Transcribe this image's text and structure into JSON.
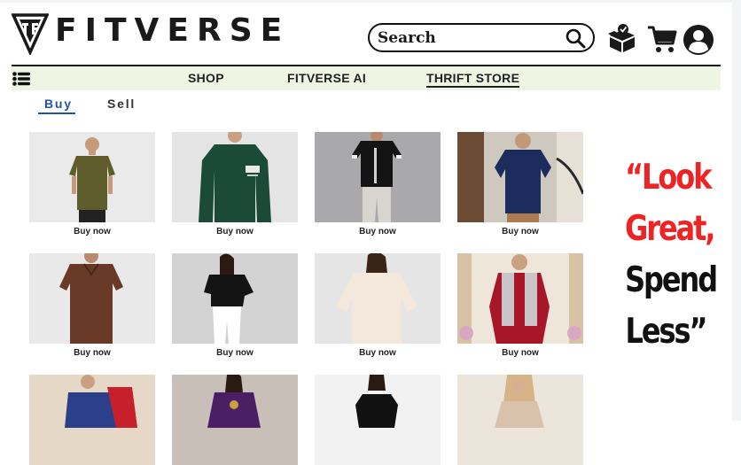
{
  "brand": {
    "name": "FITVERSE"
  },
  "search": {
    "placeholder": "Search"
  },
  "nav": {
    "items": [
      "SHOP",
      "FITVERSE AI",
      "THRIFT STORE"
    ],
    "active": "THRIFT STORE"
  },
  "tabs": {
    "buy": "Buy",
    "sell": "Sell",
    "active": "Buy"
  },
  "products": [
    {
      "action": "Buy now",
      "item": "olive t-shirt"
    },
    {
      "action": "Buy now",
      "item": "green long-sleeve tee"
    },
    {
      "action": "Buy now",
      "item": "black t-shirt"
    },
    {
      "action": "Buy now",
      "item": "navy polo"
    },
    {
      "action": "Buy now",
      "item": "brown polo"
    },
    {
      "action": "Buy now",
      "item": "black top"
    },
    {
      "action": "Buy now",
      "item": "cream top"
    },
    {
      "action": "Buy now",
      "item": "red kurta with jacket"
    },
    {
      "action": "",
      "item": "blue kurta"
    },
    {
      "action": "",
      "item": "purple kurta"
    },
    {
      "action": "",
      "item": "black dress"
    },
    {
      "action": "",
      "item": "beige top"
    }
  ],
  "tagline": {
    "line1": "“Look",
    "line2": "Great,",
    "line3": "Spend",
    "line4": "Less”"
  },
  "colors": {
    "accent_blue": "#2352a8",
    "tagline_red": "#ee2424",
    "nav_bg": "#eef6e3"
  },
  "icons": [
    "logo-icon",
    "search-icon",
    "package-icon",
    "cart-icon",
    "account-icon",
    "menu-icon"
  ]
}
